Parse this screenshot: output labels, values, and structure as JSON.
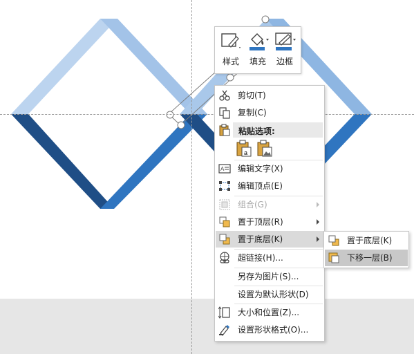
{
  "toolbar": {
    "style_label": "样式",
    "fill_label": "填充",
    "border_label": "边框"
  },
  "context_menu": {
    "cut": "剪切(T)",
    "copy": "复制(C)",
    "paste_options": "粘贴选项:",
    "edit_text": "编辑文字(X)",
    "edit_points": "编辑顶点(E)",
    "group": "组合(G)",
    "bring_to_front": "置于顶层(R)",
    "send_to_back": "置于底层(K)",
    "hyperlink": "超链接(H)...",
    "save_as_picture": "另存为图片(S)...",
    "set_default_shape": "设置为默认形状(D)",
    "size_position": "大小和位置(Z)...",
    "format_shape": "设置形状格式(O)..."
  },
  "submenu": {
    "send_to_back": "置于底层(K)",
    "send_backward": "下移一层(B)"
  },
  "colors": {
    "light_blue": "#a9c8ea",
    "mid_blue": "#5d93cf",
    "dark_blue": "#1f4e86",
    "accent_blue": "#2f75c0",
    "highlight": "#dadada"
  }
}
